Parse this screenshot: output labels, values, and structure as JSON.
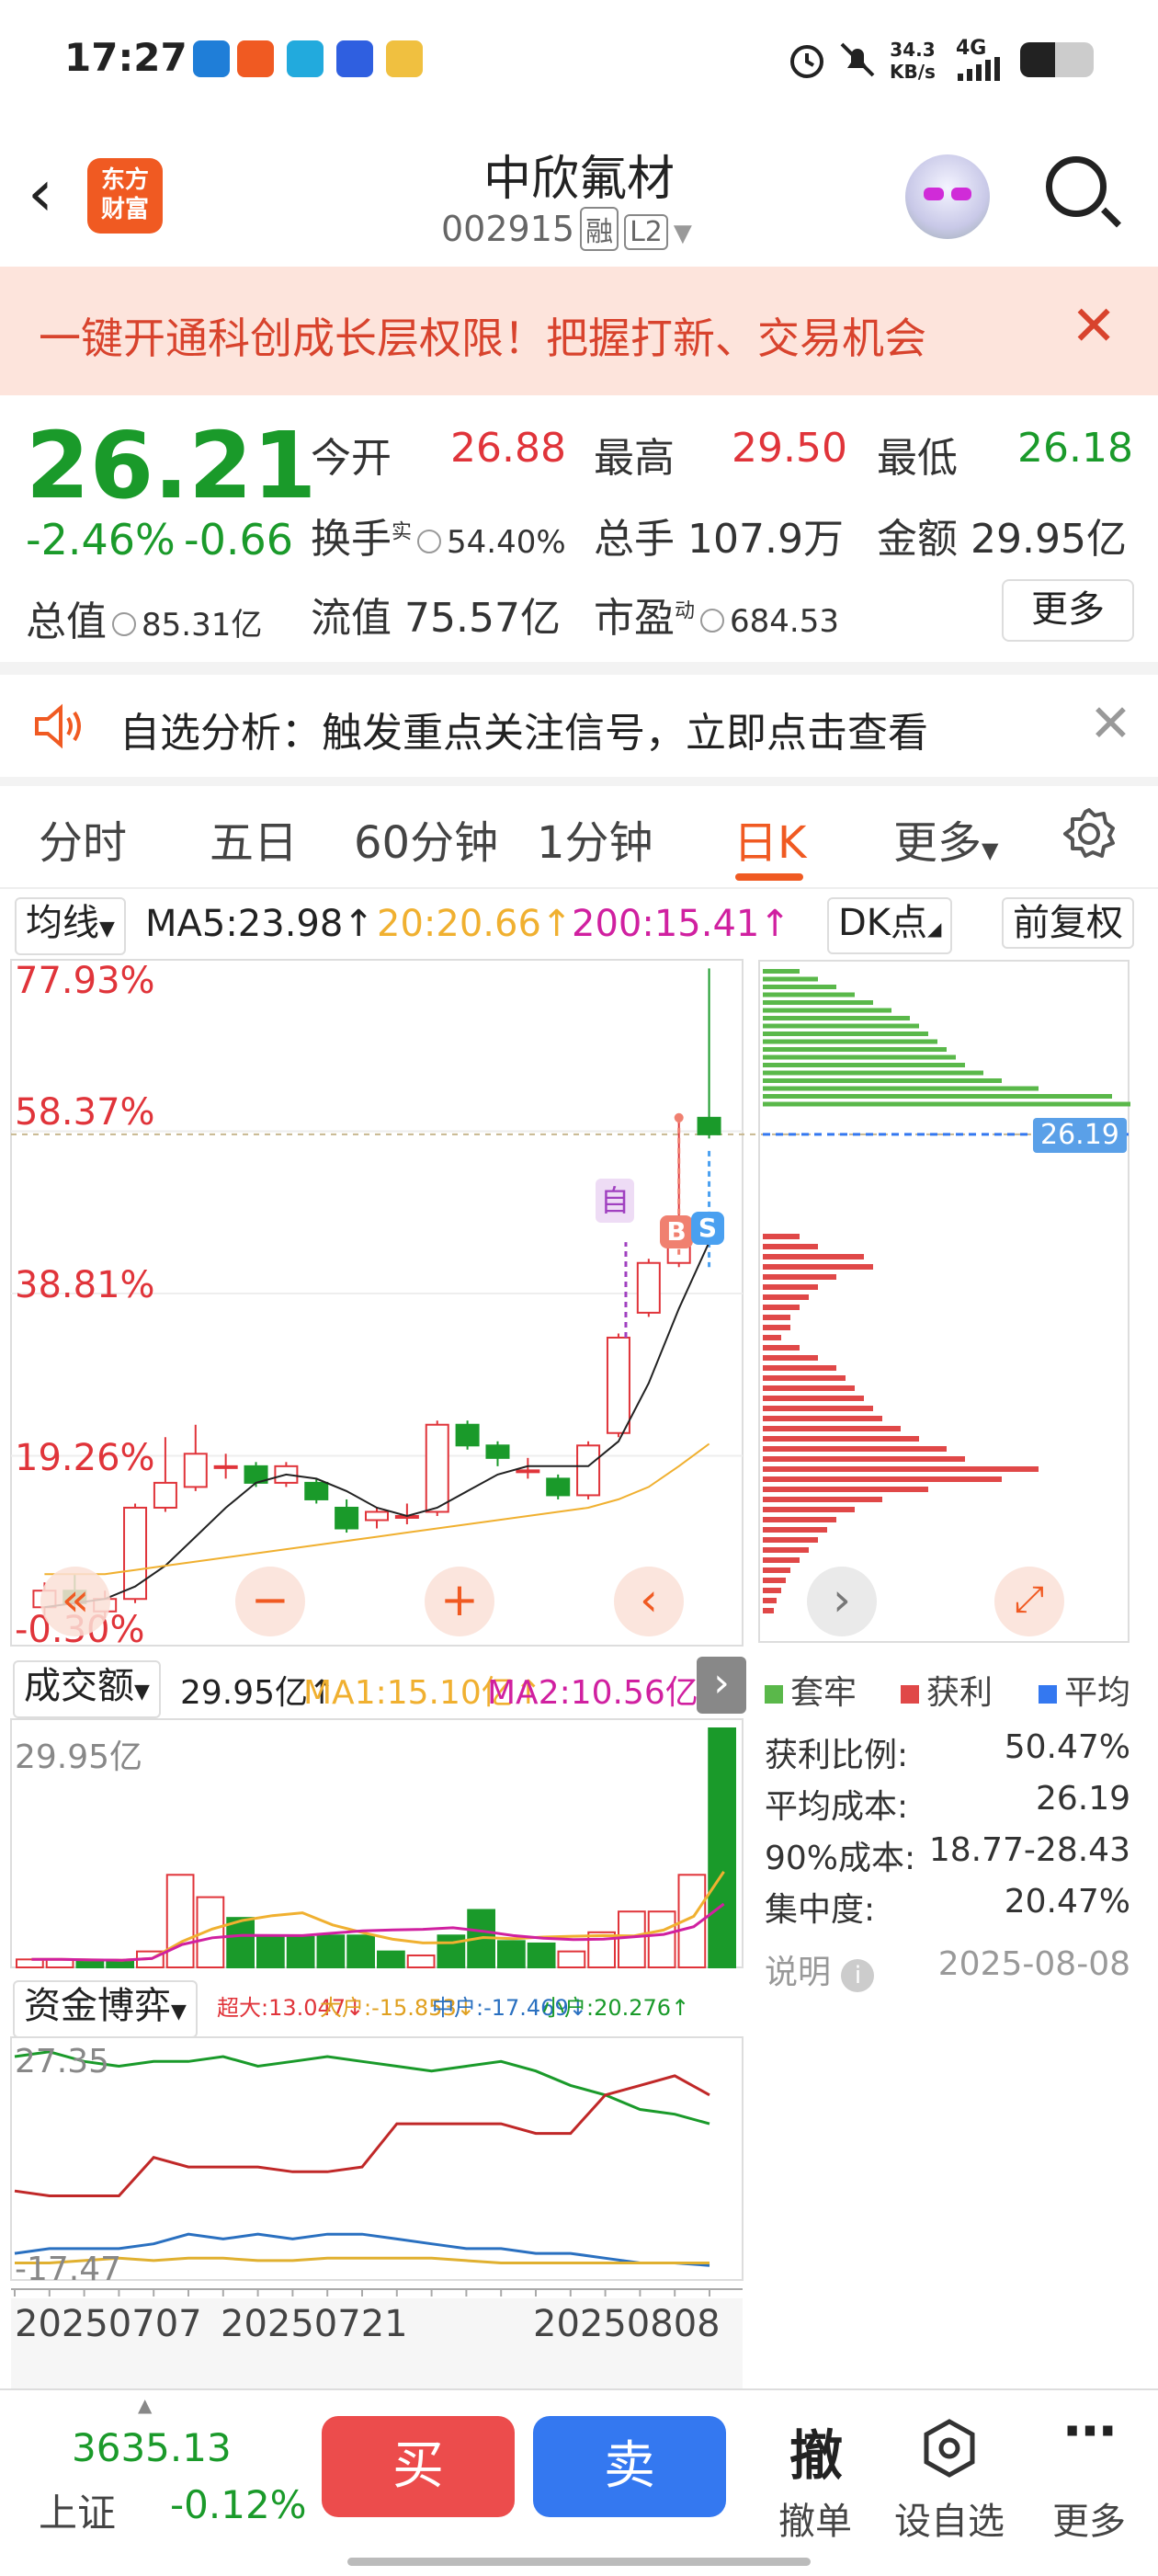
{
  "status": {
    "time": "17:27",
    "net_speed": "34.3",
    "net_unit": "KB/s",
    "signal": "4G"
  },
  "header": {
    "logo_line1": "东方",
    "logo_line2": "财富",
    "name": "中欣氟材",
    "code": "002915",
    "tag1": "融",
    "tag2": "L2"
  },
  "banner": {
    "text": "一键开通科创成长层权限！把握打新、交易机会"
  },
  "quote": {
    "price": "26.21",
    "change_pct": "-2.46%",
    "change_abs": "-0.66",
    "open_label": "今开",
    "open": "26.88",
    "high_label": "最高",
    "high": "29.50",
    "low_label": "最低",
    "low": "26.18",
    "turnover_label": "换手",
    "turnover_sup": "实",
    "turnover": "54.40%",
    "volume_label": "总手",
    "volume": "107.9万",
    "amount_label": "金额",
    "amount": "29.95亿",
    "mktcap_label": "总值",
    "mktcap": "85.31亿",
    "float_label": "流值",
    "float": "75.57亿",
    "pe_label": "市盈",
    "pe_sup": "动",
    "pe": "684.53",
    "more": "更多"
  },
  "analysis": {
    "text": "自选分析：触发重点关注信号，立即点击查看"
  },
  "tabs": [
    "分时",
    "五日",
    "60分钟",
    "1分钟",
    "日K",
    "更多"
  ],
  "ma_bar": {
    "selector": "均线",
    "ma5": "MA5:23.98",
    "ma20": "20:20.66",
    "ma200": "200:15.41",
    "dk": "DK点",
    "adjust": "前复权"
  },
  "colors": {
    "up": "#e0343a",
    "down": "#1a9a2a",
    "accent": "#f05a22",
    "ma5": "#222222",
    "ma20": "#f0b030",
    "ma200": "#d020a0",
    "buy": "#ec4c4c",
    "sell": "#3478f0"
  },
  "kchart": {
    "y_labels": [
      "77.93%",
      "58.37%",
      "38.81%",
      "19.26%",
      "-0.30%"
    ],
    "current_line": "26.19",
    "marker_self": "自",
    "marker_b": "B",
    "marker_s": "S"
  },
  "volume_bar": {
    "selector": "成交额",
    "value": "29.95亿",
    "ma1": "MA1:15.10亿",
    "ma2": "MA2:10.56亿",
    "top_label": "29.95亿"
  },
  "capital_bar": {
    "selector": "资金博弈",
    "super": "超大:13.047",
    "big": "大户:-15.853",
    "mid": "中户:-17.469",
    "small": "小户:20.276",
    "top_label": "27.35",
    "bottom_label": "-17.47"
  },
  "dates": [
    "20250707",
    "20250721",
    "20250808"
  ],
  "chip": {
    "legend": [
      "套牢",
      "获利",
      "平均"
    ],
    "rows": [
      {
        "label": "获利比例:",
        "value": "50.47%"
      },
      {
        "label": "平均成本:",
        "value": "26.19"
      },
      {
        "label": "90%成本:",
        "value": "18.77-28.43"
      },
      {
        "label": "集中度:",
        "value": "20.47%"
      }
    ],
    "note": "说明",
    "date": "2025-08-08"
  },
  "chart_data": {
    "type": "candlestick",
    "title": "",
    "ylim": [
      -0.3,
      77.93
    ],
    "candles": [
      {
        "o": 1.0,
        "c": 3.0,
        "h": 4.0,
        "l": 0.0
      },
      {
        "o": 3.0,
        "c": 1.5,
        "h": 5.0,
        "l": 0.5
      },
      {
        "o": 0.5,
        "c": 2.0,
        "h": 3.0,
        "l": -0.3
      },
      {
        "o": 2.0,
        "c": 13.0,
        "h": 13.5,
        "l": 1.5
      },
      {
        "o": 13.0,
        "c": 16.0,
        "h": 21.5,
        "l": 12.5
      },
      {
        "o": 15.5,
        "c": 19.5,
        "h": 23.0,
        "l": 15.0
      },
      {
        "o": 18.0,
        "c": 18.0,
        "h": 19.5,
        "l": 16.5
      },
      {
        "o": 18.0,
        "c": 16.0,
        "h": 18.5,
        "l": 15.5
      },
      {
        "o": 16.0,
        "c": 18.0,
        "h": 18.5,
        "l": 15.5
      },
      {
        "o": 16.0,
        "c": 14.0,
        "h": 16.5,
        "l": 13.5
      },
      {
        "o": 13.0,
        "c": 10.5,
        "h": 14.0,
        "l": 10.0
      },
      {
        "o": 11.5,
        "c": 12.5,
        "h": 13.0,
        "l": 10.5
      },
      {
        "o": 12.0,
        "c": 12.0,
        "h": 13.5,
        "l": 11.0
      },
      {
        "o": 12.5,
        "c": 23.0,
        "h": 23.5,
        "l": 12.0
      },
      {
        "o": 23.0,
        "c": 20.5,
        "h": 23.5,
        "l": 20.0
      },
      {
        "o": 20.5,
        "c": 19.0,
        "h": 21.0,
        "l": 18.0
      },
      {
        "o": 17.5,
        "c": 17.5,
        "h": 19.0,
        "l": 16.5
      },
      {
        "o": 16.5,
        "c": 14.5,
        "h": 17.0,
        "l": 14.0
      },
      {
        "o": 14.5,
        "c": 20.5,
        "h": 21.0,
        "l": 14.0
      },
      {
        "o": 22.0,
        "c": 33.5,
        "h": 34.0,
        "l": 21.5
      },
      {
        "o": 36.5,
        "c": 42.5,
        "h": 43.0,
        "l": 36.0
      },
      {
        "o": 42.5,
        "c": 45.5,
        "h": 60.0,
        "l": 42.0
      },
      {
        "o": 60.0,
        "c": 58.0,
        "h": 78.0,
        "l": 57.5
      }
    ],
    "ma5": [
      1,
      1.5,
      2,
      3.5,
      6,
      9.5,
      13,
      16,
      17,
      16.5,
      15,
      13,
      12,
      13,
      15,
      17,
      18,
      18,
      18,
      21,
      28,
      37,
      45
    ],
    "ma20": [
      5,
      5,
      5,
      5.5,
      6,
      6.5,
      7,
      7.5,
      8,
      8.5,
      9,
      9.5,
      10,
      10.5,
      11,
      11.5,
      12,
      12.5,
      13,
      14,
      15.5,
      18,
      20.7
    ],
    "volume": [
      1.0,
      1.0,
      0.8,
      0.8,
      2.0,
      11.6,
      8.8,
      6.2,
      3.8,
      3.8,
      4.0,
      4.0,
      2.0,
      1.5,
      4.0,
      7.2,
      3.3,
      3.0,
      2.0,
      4.4,
      7.0,
      7.0,
      11.6,
      29.95
    ],
    "capital_super": [
      26,
      27,
      25,
      24,
      25,
      25,
      26,
      24,
      25,
      26,
      25,
      24,
      23,
      24,
      25,
      23,
      20,
      18,
      15,
      14,
      12
    ],
    "capital_big": [
      -2,
      -3,
      -3,
      -3,
      5,
      3,
      3,
      3,
      2,
      2,
      3,
      12,
      12,
      12,
      12,
      10,
      10,
      18,
      20,
      22,
      18
    ],
    "capital_mid": [
      -15,
      -14,
      -14,
      -14,
      -13,
      -11,
      -12,
      -11,
      -12,
      -11,
      -11,
      -12,
      -13,
      -14,
      -14,
      -15,
      -15,
      -16,
      -17,
      -17,
      -17.5
    ],
    "capital_small": [
      -17,
      -17,
      -16.5,
      -16,
      -16.5,
      -16,
      -16,
      -16.5,
      -16.5,
      -16,
      -16,
      -16,
      -16,
      -16.5,
      -17,
      -17,
      -17,
      -17,
      -17,
      -17,
      -17
    ]
  }
}
